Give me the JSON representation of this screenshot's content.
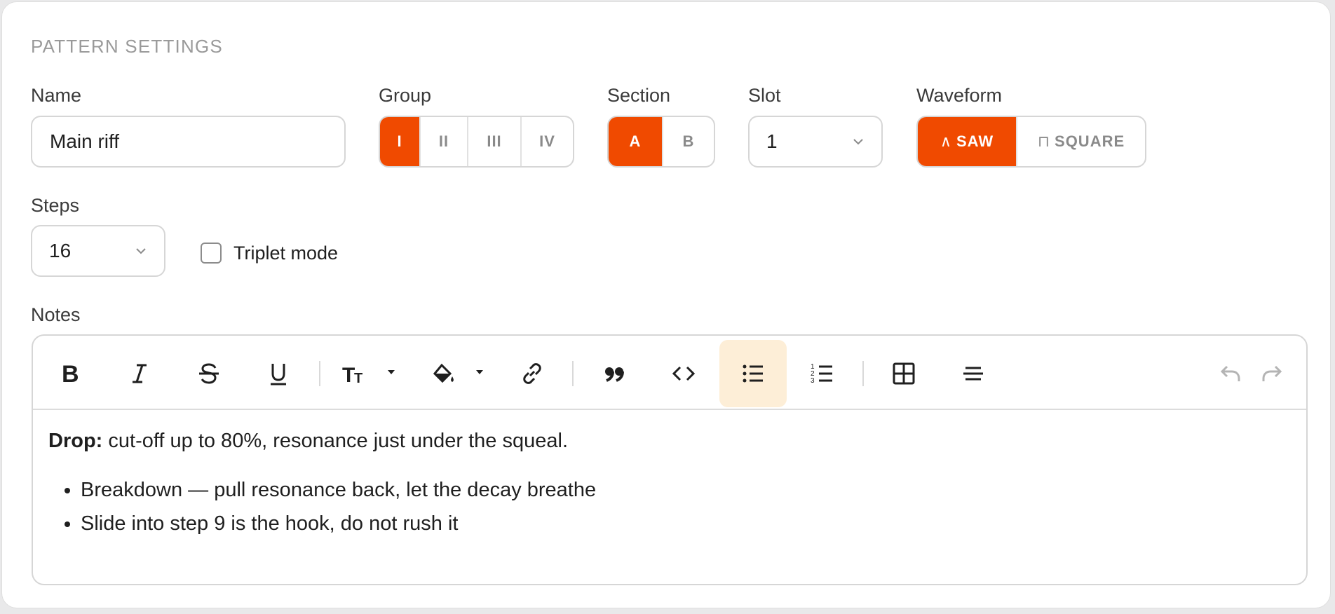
{
  "section_title": "PATTERN SETTINGS",
  "name_field": {
    "label": "Name",
    "value": "Main riff"
  },
  "group": {
    "label": "Group",
    "options": [
      "I",
      "II",
      "III",
      "IV"
    ],
    "selected": "I"
  },
  "section": {
    "label": "Section",
    "options": [
      "A",
      "B"
    ],
    "selected": "A"
  },
  "slot": {
    "label": "Slot",
    "value": "1"
  },
  "waveform": {
    "label": "Waveform",
    "options": [
      {
        "icon": "saw-wave-icon",
        "glyph": "∧",
        "text": "SAW"
      },
      {
        "icon": "square-wave-icon",
        "glyph": "⊓",
        "text": "SQUARE"
      }
    ],
    "selected": "SAW"
  },
  "steps": {
    "label": "Steps",
    "value": "16"
  },
  "triplet": {
    "label": "Triplet mode",
    "checked": false
  },
  "notes": {
    "label": "Notes",
    "toolbar": [
      "bold-icon",
      "italic-icon",
      "strikethrough-icon",
      "underline-icon",
      "text-size-icon",
      "fill-color-icon",
      "link-icon",
      "quote-icon",
      "code-icon",
      "bullet-list-icon",
      "numbered-list-icon",
      "table-icon",
      "align-center-icon",
      "undo-icon",
      "redo-icon"
    ],
    "active_tool": "bullet-list-icon",
    "paragraph_bold": "Drop:",
    "paragraph_rest": " cut-off up to 80%, resonance just under the squeal.",
    "bullets": [
      "Breakdown — pull resonance back, let the decay breathe",
      "Slide into step 9 is the hook, do not rush it"
    ]
  },
  "colors": {
    "accent": "#f04a00",
    "active_tool_bg": "#fdeed7"
  }
}
